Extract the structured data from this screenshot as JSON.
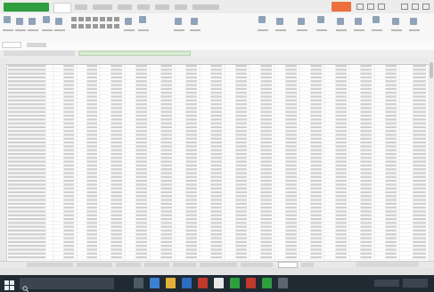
{
  "colors": {
    "app_accent": "#2e9e3e",
    "sign_in_button": "#ee6f3c",
    "file_tab_active": "#d8ead2",
    "grid_line": "#dedede",
    "cell_fill": "#cfcfcf",
    "taskbar": "#1f2a33"
  },
  "icons": {
    "start": "start-icon",
    "search": "search-icon"
  }
}
